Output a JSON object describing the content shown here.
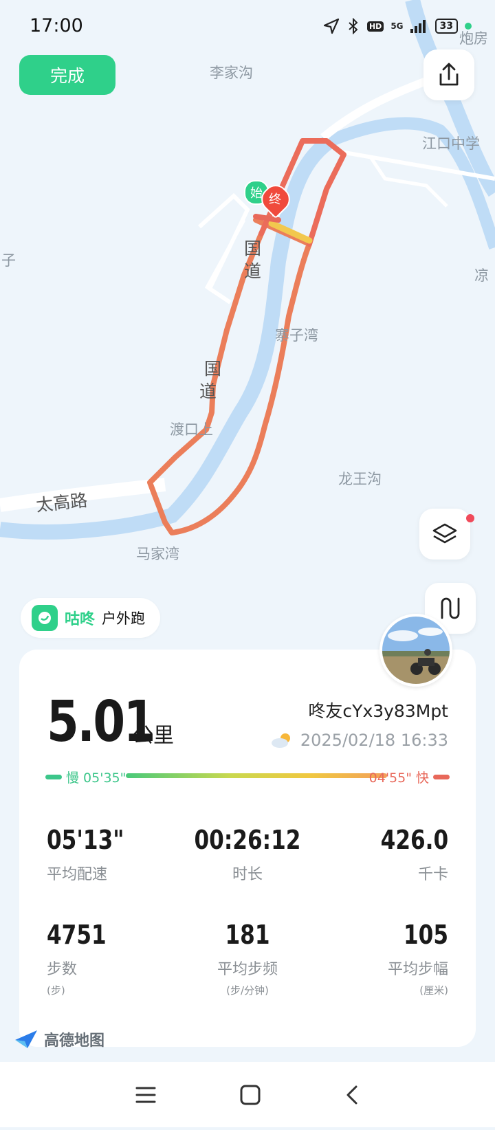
{
  "status_bar": {
    "time": "17:00",
    "hd": "HD",
    "network": "5G",
    "battery": "33",
    "icons": [
      "location-arrow-icon",
      "bluetooth-icon",
      "hd-icon",
      "signal-icon",
      "battery-icon"
    ]
  },
  "toolbar": {
    "done_label": "完成",
    "share_icon": "share-icon",
    "layers_icon": "layers-icon",
    "route_icon": "route-toggle-icon"
  },
  "map": {
    "places": {
      "lijiagou": "李家沟",
      "paofang": "炮房",
      "jiangkou": "江口中学",
      "zi_left": "子",
      "liang": "凉",
      "zhaiziwan": "寨子湾",
      "dukoushang": "渡口上",
      "longwanggou": "龙王沟",
      "majiawan": "马家湾",
      "taigaolu": "太高路",
      "guodao_a": "国",
      "guodao_b": "道",
      "guodao_c": "国",
      "guodao_d": "道"
    },
    "start_marker": "始",
    "end_marker": "终",
    "provider": "高德地图"
  },
  "brand": {
    "name": "咕咚",
    "mode": "户外跑"
  },
  "summary": {
    "distance": "5.01",
    "distance_unit": "公里",
    "username": "咚友cYx3y83Mpt",
    "datetime": "2025/02/18 16:33",
    "weather_icon": "partly-cloudy-icon",
    "pace_slow_label": "慢 05'35\"",
    "pace_fast_label": "04'55\" 快",
    "colors": {
      "accent": "#2fd08a",
      "slow": "#3cc68a",
      "fast": "#e8685a"
    }
  },
  "stats": [
    {
      "value": "05'13\"",
      "label": "平均配速",
      "unit": ""
    },
    {
      "value": "00:26:12",
      "label": "时长",
      "unit": ""
    },
    {
      "value": "426.0",
      "label": "千卡",
      "unit": ""
    },
    {
      "value": "4751",
      "label": "步数",
      "unit": "(步)"
    },
    {
      "value": "181",
      "label": "平均步频",
      "unit": "(步/分钟)"
    },
    {
      "value": "105",
      "label": "平均步幅",
      "unit": "(厘米)"
    }
  ],
  "nav": {
    "icons": [
      "menu-icon",
      "home-icon",
      "back-icon"
    ]
  }
}
